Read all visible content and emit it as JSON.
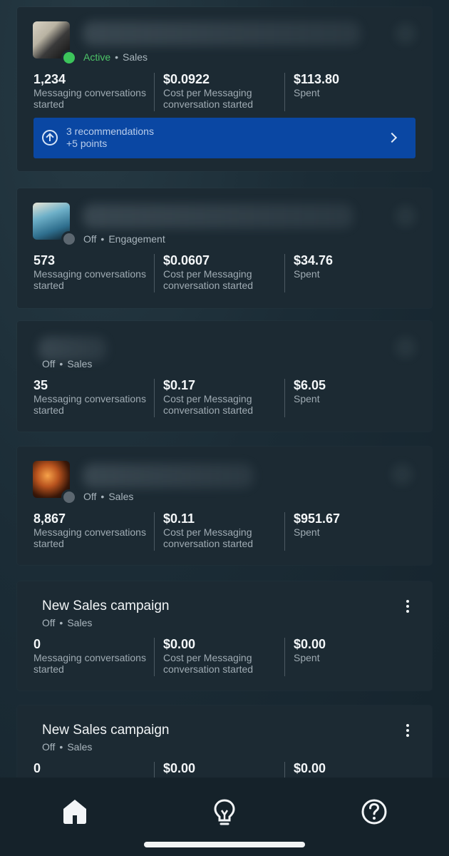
{
  "cards": [
    {
      "status": "Active",
      "objective": "Sales",
      "metrics": [
        {
          "value": "1,234",
          "label": "Messaging conversations started"
        },
        {
          "value": "$0.0922",
          "label": "Cost per Messaging conversation started"
        },
        {
          "value": "$113.80",
          "label": "Spent"
        }
      ],
      "recommendation": {
        "line1": "3 recommendations",
        "line2": "+5 points"
      }
    },
    {
      "status": "Off",
      "objective": "Engagement",
      "metrics": [
        {
          "value": "573",
          "label": "Messaging conversations started"
        },
        {
          "value": "$0.0607",
          "label": "Cost per Messaging conversation started"
        },
        {
          "value": "$34.76",
          "label": "Spent"
        }
      ]
    },
    {
      "status": "Off",
      "objective": "Sales",
      "metrics": [
        {
          "value": "35",
          "label": "Messaging conversations started"
        },
        {
          "value": "$0.17",
          "label": "Cost per Messaging conversation started"
        },
        {
          "value": "$6.05",
          "label": "Spent"
        }
      ]
    },
    {
      "status": "Off",
      "objective": "Sales",
      "metrics": [
        {
          "value": "8,867",
          "label": "Messaging conversations started"
        },
        {
          "value": "$0.11",
          "label": "Cost per Messaging conversation started"
        },
        {
          "value": "$951.67",
          "label": "Spent"
        }
      ]
    },
    {
      "title": "New Sales campaign",
      "status": "Off",
      "objective": "Sales",
      "metrics": [
        {
          "value": "0",
          "label": "Messaging conversations started"
        },
        {
          "value": "$0.00",
          "label": "Cost per Messaging conversation started"
        },
        {
          "value": "$0.00",
          "label": "Spent"
        }
      ]
    },
    {
      "title": "New Sales campaign",
      "status": "Off",
      "objective": "Sales",
      "metrics": [
        {
          "value": "0",
          "label": ""
        },
        {
          "value": "$0.00",
          "label": ""
        },
        {
          "value": "$0.00",
          "label": ""
        }
      ]
    }
  ],
  "colors": {
    "active_status": "#4dc468",
    "recommendation_bg": "#0a47a3",
    "card_bg": "#1c2a33"
  },
  "nav": [
    {
      "icon": "home-icon"
    },
    {
      "icon": "lightbulb-icon"
    },
    {
      "icon": "help-icon"
    }
  ]
}
